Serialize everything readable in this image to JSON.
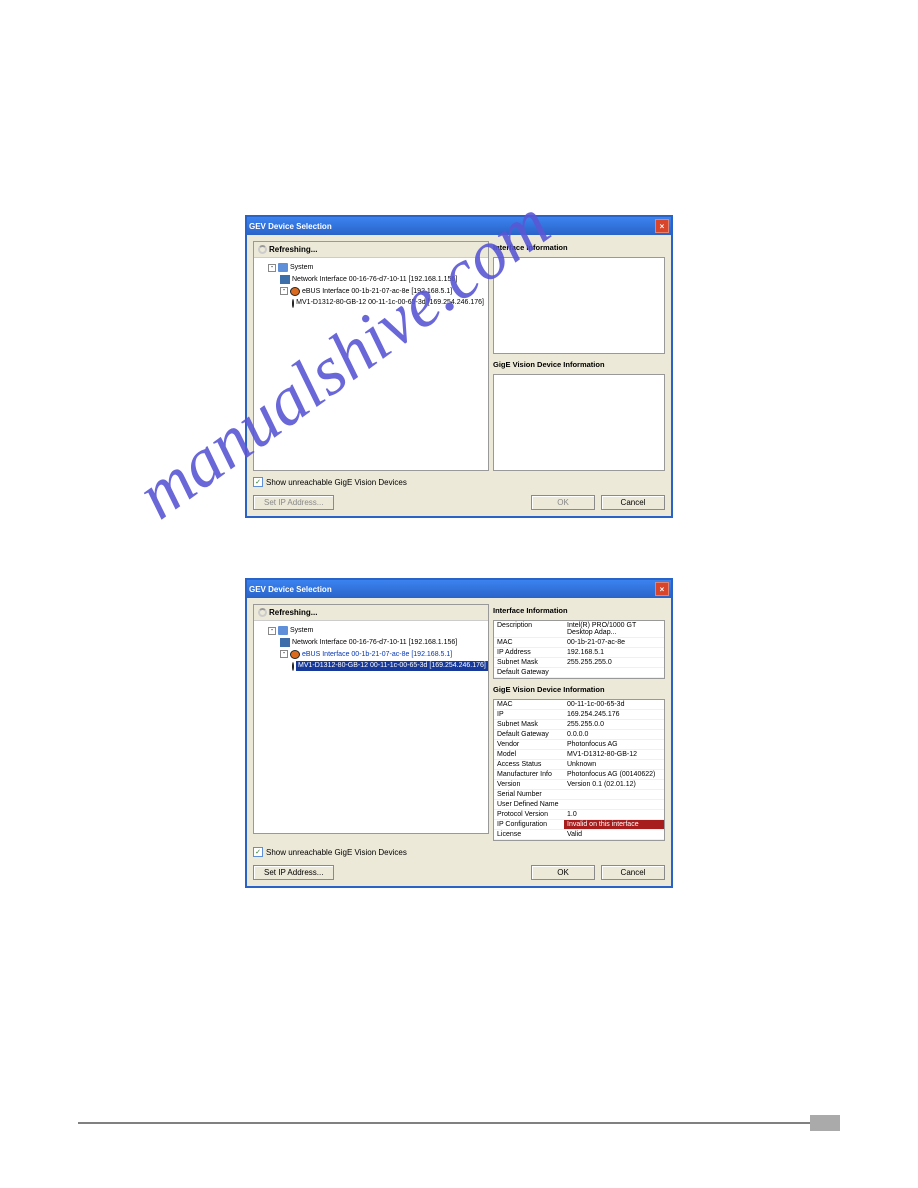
{
  "dialog_title": "GEV Device Selection",
  "refreshing_label": "Refreshing...",
  "show_unreachable_label": "Show unreachable GigE Vision Devices",
  "buttons": {
    "set_ip": "Set IP Address...",
    "ok": "OK",
    "cancel": "Cancel"
  },
  "section": {
    "iface": "Interface Information",
    "device": "GigE Vision Device Information"
  },
  "tree": {
    "system": "System",
    "net_if": "Network Interface  00-16-76-d7-10-11 [192.168.1.156]",
    "ebus_if": "eBUS Interface  00-1b-21-07-ac-8e [192.168.5.1]",
    "cam": "MV1-D1312-80-GB-12 00-11-1c-00-65-3d [169.254.246.176]"
  },
  "iface_props": [
    {
      "k": "Description",
      "v": "Intel(R) PRO/1000 GT Desktop Adap..."
    },
    {
      "k": "MAC",
      "v": "00-1b-21-07-ac-8e"
    },
    {
      "k": "IP Address",
      "v": "192.168.5.1"
    },
    {
      "k": "Subnet Mask",
      "v": "255.255.255.0"
    },
    {
      "k": "Default Gateway",
      "v": ""
    }
  ],
  "device_props": [
    {
      "k": "MAC",
      "v": "00-11-1c-00-65-3d"
    },
    {
      "k": "IP",
      "v": "169.254.245.176"
    },
    {
      "k": "Subnet Mask",
      "v": "255.255.0.0"
    },
    {
      "k": "Default Gateway",
      "v": "0.0.0.0"
    },
    {
      "k": "Vendor",
      "v": "Photonfocus AG"
    },
    {
      "k": "Model",
      "v": "MV1-D1312-80-GB-12"
    },
    {
      "k": "Access Status",
      "v": "Unknown"
    },
    {
      "k": "Manufacturer Info",
      "v": "Photonfocus AG (00140622)"
    },
    {
      "k": "Version",
      "v": "Version 0.1 (02.01.12)"
    },
    {
      "k": "Serial Number",
      "v": ""
    },
    {
      "k": "User Defined Name",
      "v": ""
    },
    {
      "k": "Protocol Version",
      "v": "1.0"
    },
    {
      "k": "IP Configuration",
      "v": "Invalid on this interface",
      "invalid": true
    },
    {
      "k": "License",
      "v": "Valid"
    }
  ]
}
